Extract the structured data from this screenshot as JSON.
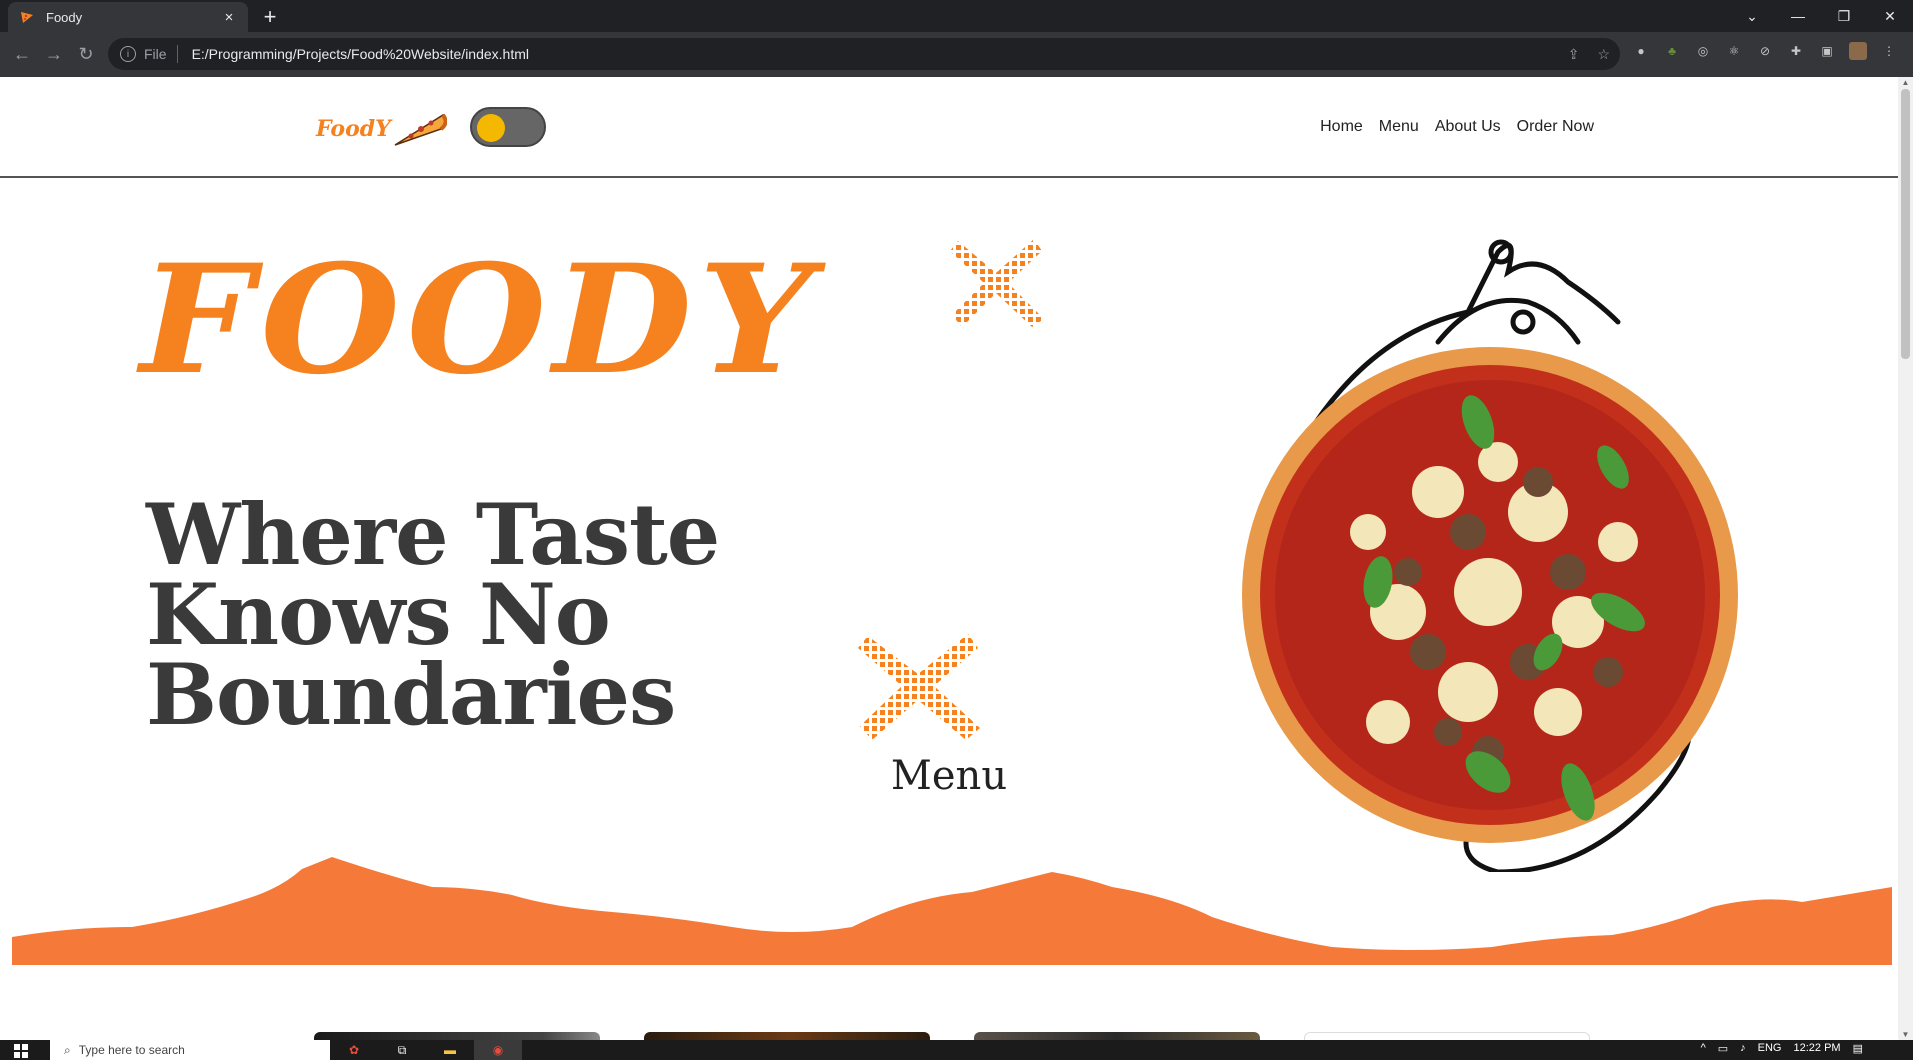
{
  "browser": {
    "tab_title": "Foody",
    "url_scheme_label": "File",
    "url": "E:/Programming/Projects/Food%20Website/index.html",
    "new_tab_symbol": "+",
    "close_symbol": "×"
  },
  "site": {
    "logo_text": "FoodY",
    "nav": [
      {
        "label": "Home"
      },
      {
        "label": "Menu"
      },
      {
        "label": "About Us"
      },
      {
        "label": "Order Now"
      }
    ],
    "theme_toggle": {
      "state": "light"
    }
  },
  "hero": {
    "title": "FOODY",
    "tagline": "Where Taste Knows No Boundaries"
  },
  "menu": {
    "title": "Menu"
  },
  "taskbar": {
    "search_placeholder": "Type here to search",
    "language": "ENG",
    "time": "12:22 PM"
  },
  "colors": {
    "accent": "#f5821f",
    "dark_text": "#3a3a3a",
    "chrome_bg": "#202124",
    "toolbar_bg": "#35363a"
  }
}
